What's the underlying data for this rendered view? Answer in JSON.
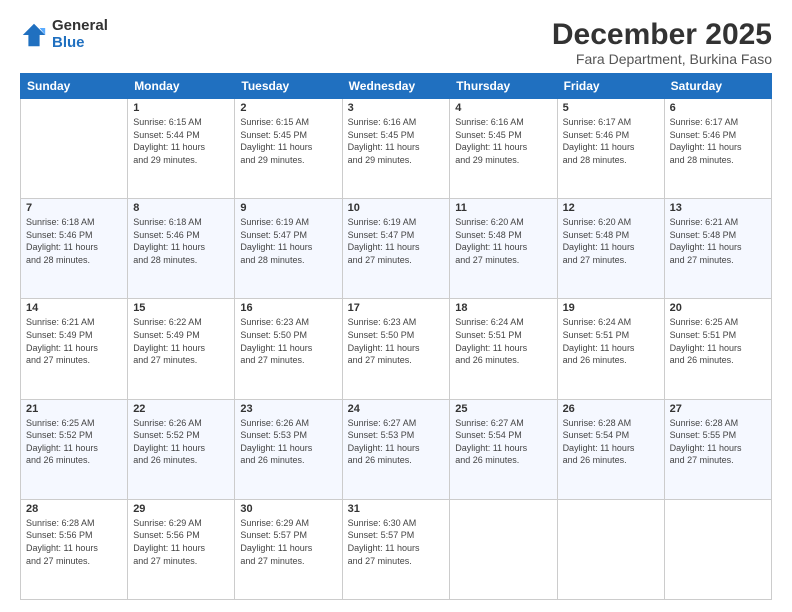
{
  "logo": {
    "general": "General",
    "blue": "Blue"
  },
  "title": "December 2025",
  "subtitle": "Fara Department, Burkina Faso",
  "days_header": [
    "Sunday",
    "Monday",
    "Tuesday",
    "Wednesday",
    "Thursday",
    "Friday",
    "Saturday"
  ],
  "weeks": [
    [
      {
        "day": "",
        "info": ""
      },
      {
        "day": "1",
        "info": "Sunrise: 6:15 AM\nSunset: 5:44 PM\nDaylight: 11 hours\nand 29 minutes."
      },
      {
        "day": "2",
        "info": "Sunrise: 6:15 AM\nSunset: 5:45 PM\nDaylight: 11 hours\nand 29 minutes."
      },
      {
        "day": "3",
        "info": "Sunrise: 6:16 AM\nSunset: 5:45 PM\nDaylight: 11 hours\nand 29 minutes."
      },
      {
        "day": "4",
        "info": "Sunrise: 6:16 AM\nSunset: 5:45 PM\nDaylight: 11 hours\nand 29 minutes."
      },
      {
        "day": "5",
        "info": "Sunrise: 6:17 AM\nSunset: 5:46 PM\nDaylight: 11 hours\nand 28 minutes."
      },
      {
        "day": "6",
        "info": "Sunrise: 6:17 AM\nSunset: 5:46 PM\nDaylight: 11 hours\nand 28 minutes."
      }
    ],
    [
      {
        "day": "7",
        "info": "Sunrise: 6:18 AM\nSunset: 5:46 PM\nDaylight: 11 hours\nand 28 minutes."
      },
      {
        "day": "8",
        "info": "Sunrise: 6:18 AM\nSunset: 5:46 PM\nDaylight: 11 hours\nand 28 minutes."
      },
      {
        "day": "9",
        "info": "Sunrise: 6:19 AM\nSunset: 5:47 PM\nDaylight: 11 hours\nand 28 minutes."
      },
      {
        "day": "10",
        "info": "Sunrise: 6:19 AM\nSunset: 5:47 PM\nDaylight: 11 hours\nand 27 minutes."
      },
      {
        "day": "11",
        "info": "Sunrise: 6:20 AM\nSunset: 5:48 PM\nDaylight: 11 hours\nand 27 minutes."
      },
      {
        "day": "12",
        "info": "Sunrise: 6:20 AM\nSunset: 5:48 PM\nDaylight: 11 hours\nand 27 minutes."
      },
      {
        "day": "13",
        "info": "Sunrise: 6:21 AM\nSunset: 5:48 PM\nDaylight: 11 hours\nand 27 minutes."
      }
    ],
    [
      {
        "day": "14",
        "info": "Sunrise: 6:21 AM\nSunset: 5:49 PM\nDaylight: 11 hours\nand 27 minutes."
      },
      {
        "day": "15",
        "info": "Sunrise: 6:22 AM\nSunset: 5:49 PM\nDaylight: 11 hours\nand 27 minutes."
      },
      {
        "day": "16",
        "info": "Sunrise: 6:23 AM\nSunset: 5:50 PM\nDaylight: 11 hours\nand 27 minutes."
      },
      {
        "day": "17",
        "info": "Sunrise: 6:23 AM\nSunset: 5:50 PM\nDaylight: 11 hours\nand 27 minutes."
      },
      {
        "day": "18",
        "info": "Sunrise: 6:24 AM\nSunset: 5:51 PM\nDaylight: 11 hours\nand 26 minutes."
      },
      {
        "day": "19",
        "info": "Sunrise: 6:24 AM\nSunset: 5:51 PM\nDaylight: 11 hours\nand 26 minutes."
      },
      {
        "day": "20",
        "info": "Sunrise: 6:25 AM\nSunset: 5:51 PM\nDaylight: 11 hours\nand 26 minutes."
      }
    ],
    [
      {
        "day": "21",
        "info": "Sunrise: 6:25 AM\nSunset: 5:52 PM\nDaylight: 11 hours\nand 26 minutes."
      },
      {
        "day": "22",
        "info": "Sunrise: 6:26 AM\nSunset: 5:52 PM\nDaylight: 11 hours\nand 26 minutes."
      },
      {
        "day": "23",
        "info": "Sunrise: 6:26 AM\nSunset: 5:53 PM\nDaylight: 11 hours\nand 26 minutes."
      },
      {
        "day": "24",
        "info": "Sunrise: 6:27 AM\nSunset: 5:53 PM\nDaylight: 11 hours\nand 26 minutes."
      },
      {
        "day": "25",
        "info": "Sunrise: 6:27 AM\nSunset: 5:54 PM\nDaylight: 11 hours\nand 26 minutes."
      },
      {
        "day": "26",
        "info": "Sunrise: 6:28 AM\nSunset: 5:54 PM\nDaylight: 11 hours\nand 26 minutes."
      },
      {
        "day": "27",
        "info": "Sunrise: 6:28 AM\nSunset: 5:55 PM\nDaylight: 11 hours\nand 27 minutes."
      }
    ],
    [
      {
        "day": "28",
        "info": "Sunrise: 6:28 AM\nSunset: 5:56 PM\nDaylight: 11 hours\nand 27 minutes."
      },
      {
        "day": "29",
        "info": "Sunrise: 6:29 AM\nSunset: 5:56 PM\nDaylight: 11 hours\nand 27 minutes."
      },
      {
        "day": "30",
        "info": "Sunrise: 6:29 AM\nSunset: 5:57 PM\nDaylight: 11 hours\nand 27 minutes."
      },
      {
        "day": "31",
        "info": "Sunrise: 6:30 AM\nSunset: 5:57 PM\nDaylight: 11 hours\nand 27 minutes."
      },
      {
        "day": "",
        "info": ""
      },
      {
        "day": "",
        "info": ""
      },
      {
        "day": "",
        "info": ""
      }
    ]
  ]
}
